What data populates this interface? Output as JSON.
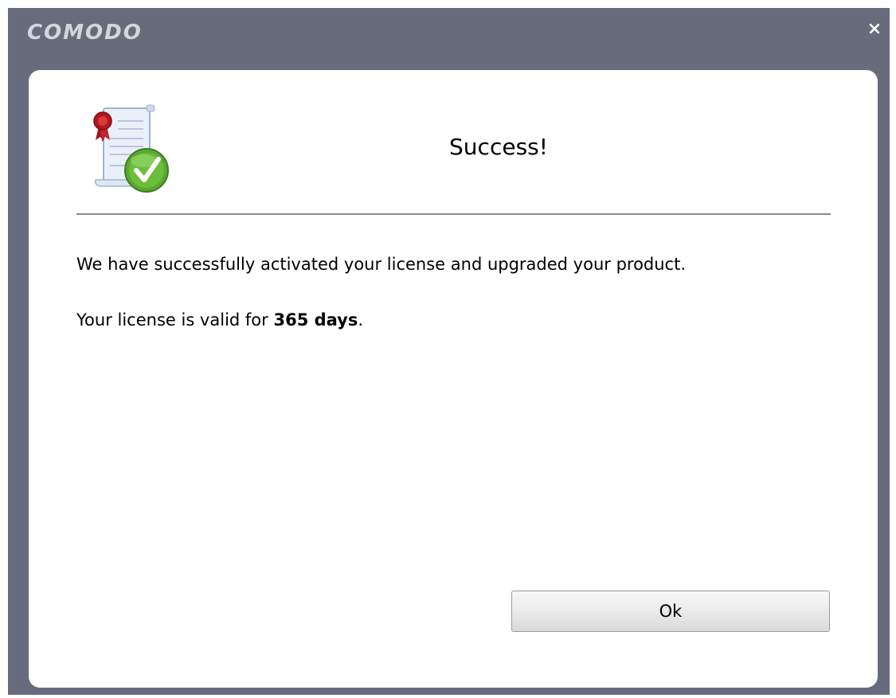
{
  "window": {
    "brand": "COMODO",
    "close_label": "×"
  },
  "dialog": {
    "heading": "Success!",
    "message_line1": "We have successfully activated your license and upgraded your product.",
    "message_line2_prefix": "Your license is valid for ",
    "message_line2_value": "365 days",
    "message_line2_suffix": ".",
    "ok_label": "Ok"
  },
  "icons": {
    "certificate": "certificate-check-icon",
    "close": "close-icon"
  },
  "colors": {
    "frame": "#676b7c",
    "panel": "#ffffff",
    "divider": "#8a8a8a",
    "check_green": "#5aa832"
  }
}
